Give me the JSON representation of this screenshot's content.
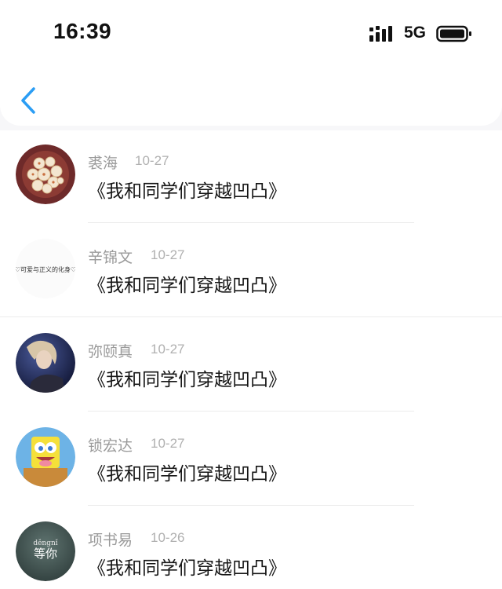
{
  "status_bar": {
    "time": "16:39",
    "network": "5G",
    "signal_icon": "signal-bars-icon",
    "battery_icon": "battery-icon"
  },
  "nav": {
    "back_icon": "chevron-left-icon",
    "accent_color": "#2b9df4"
  },
  "items": [
    {
      "name": "裘海",
      "date": "10-27",
      "title": "《我和同学们穿越凹凸》",
      "avatar": "avatar-pastry-photo"
    },
    {
      "name": "辛锦文",
      "date": "10-27",
      "title": "《我和同学们穿越凹凸》",
      "avatar": "avatar-text",
      "avatar_text": "♡可爱与正义的化身♡"
    },
    {
      "name": "弥颐真",
      "date": "10-27",
      "title": "《我和同学们穿越凹凸》",
      "avatar": "avatar-portrait-photo"
    },
    {
      "name": "锁宏达",
      "date": "10-27",
      "title": "《我和同学们穿越凹凸》",
      "avatar": "avatar-cartoon-sponge"
    },
    {
      "name": "项书易",
      "date": "10-26",
      "title": "《我和同学们穿越凹凸》",
      "avatar": "avatar-text-dark",
      "avatar_text_top": "děngnǐ",
      "avatar_text_bottom": "等你"
    }
  ]
}
